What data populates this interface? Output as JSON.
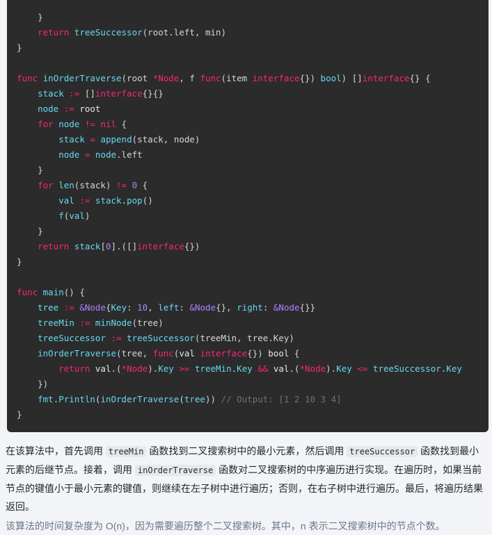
{
  "theme": {
    "page_background": "#f2f4f8",
    "code_background": "#2b2b2b",
    "code_default_text": "#d6d6d6",
    "keyword_color": "#f92672",
    "identifier_color": "#66d9ef",
    "number_color": "#ae81ff",
    "comment_color": "#75715e",
    "prose_color": "#1f2328",
    "prose_dim_color": "#6b7785",
    "inline_code_background": "#e6e8ec"
  },
  "code_block": {
    "language": "go",
    "lines": [
      [
        {
          "t": "    }",
          "c": "pun"
        }
      ],
      [
        {
          "t": "    ",
          "c": "pun"
        },
        {
          "t": "return",
          "c": "kw"
        },
        {
          "t": " ",
          "c": "pun"
        },
        {
          "t": "treeSuccessor",
          "c": "id"
        },
        {
          "t": "(root.left, min)",
          "c": "pun"
        }
      ],
      [
        {
          "t": "}",
          "c": "pun"
        }
      ],
      [
        {
          "t": "",
          "c": "pun"
        }
      ],
      [
        {
          "t": "func",
          "c": "kw"
        },
        {
          "t": " ",
          "c": "pun"
        },
        {
          "t": "inOrderTraverse",
          "c": "id"
        },
        {
          "t": "(root ",
          "c": "pun"
        },
        {
          "t": "*Node",
          "c": "typ"
        },
        {
          "t": ", f ",
          "c": "pun"
        },
        {
          "t": "func",
          "c": "kw"
        },
        {
          "t": "(item ",
          "c": "pun"
        },
        {
          "t": "interface",
          "c": "typ"
        },
        {
          "t": "{}) ",
          "c": "pun"
        },
        {
          "t": "bool",
          "c": "id"
        },
        {
          "t": ") []",
          "c": "pun"
        },
        {
          "t": "interface",
          "c": "typ"
        },
        {
          "t": "{} {",
          "c": "pun"
        }
      ],
      [
        {
          "t": "    ",
          "c": "pun"
        },
        {
          "t": "stack",
          "c": "id"
        },
        {
          "t": " ",
          "c": "pun"
        },
        {
          "t": ":=",
          "c": "kw"
        },
        {
          "t": " []",
          "c": "pun"
        },
        {
          "t": "interface",
          "c": "typ"
        },
        {
          "t": "{}{}",
          "c": "pun"
        }
      ],
      [
        {
          "t": "    ",
          "c": "pun"
        },
        {
          "t": "node",
          "c": "id"
        },
        {
          "t": " ",
          "c": "pun"
        },
        {
          "t": ":=",
          "c": "kw"
        },
        {
          "t": " ",
          "c": "pun"
        },
        {
          "t": "root",
          "c": "plain"
        }
      ],
      [
        {
          "t": "    ",
          "c": "pun"
        },
        {
          "t": "for",
          "c": "kw"
        },
        {
          "t": " ",
          "c": "pun"
        },
        {
          "t": "node",
          "c": "id"
        },
        {
          "t": " ",
          "c": "pun"
        },
        {
          "t": "!=",
          "c": "kw"
        },
        {
          "t": " ",
          "c": "pun"
        },
        {
          "t": "nil",
          "c": "typ"
        },
        {
          "t": " {",
          "c": "pun"
        }
      ],
      [
        {
          "t": "        ",
          "c": "pun"
        },
        {
          "t": "stack",
          "c": "id"
        },
        {
          "t": " ",
          "c": "pun"
        },
        {
          "t": "=",
          "c": "kw"
        },
        {
          "t": " ",
          "c": "pun"
        },
        {
          "t": "append",
          "c": "id"
        },
        {
          "t": "(stack, node)",
          "c": "pun"
        }
      ],
      [
        {
          "t": "        ",
          "c": "pun"
        },
        {
          "t": "node",
          "c": "id"
        },
        {
          "t": " ",
          "c": "pun"
        },
        {
          "t": "=",
          "c": "kw"
        },
        {
          "t": " ",
          "c": "pun"
        },
        {
          "t": "node",
          "c": "id"
        },
        {
          "t": ".left",
          "c": "pun"
        }
      ],
      [
        {
          "t": "    }",
          "c": "pun"
        }
      ],
      [
        {
          "t": "    ",
          "c": "pun"
        },
        {
          "t": "for",
          "c": "kw"
        },
        {
          "t": " ",
          "c": "pun"
        },
        {
          "t": "len",
          "c": "id"
        },
        {
          "t": "(stack) ",
          "c": "pun"
        },
        {
          "t": "!=",
          "c": "kw"
        },
        {
          "t": " ",
          "c": "pun"
        },
        {
          "t": "0",
          "c": "num"
        },
        {
          "t": " {",
          "c": "pun"
        }
      ],
      [
        {
          "t": "        ",
          "c": "pun"
        },
        {
          "t": "val",
          "c": "id"
        },
        {
          "t": " ",
          "c": "pun"
        },
        {
          "t": ":=",
          "c": "kw"
        },
        {
          "t": " ",
          "c": "pun"
        },
        {
          "t": "stack",
          "c": "id"
        },
        {
          "t": ".",
          "c": "pun"
        },
        {
          "t": "pop",
          "c": "id"
        },
        {
          "t": "()",
          "c": "pun"
        }
      ],
      [
        {
          "t": "        ",
          "c": "pun"
        },
        {
          "t": "f",
          "c": "id"
        },
        {
          "t": "(",
          "c": "pun"
        },
        {
          "t": "val",
          "c": "id"
        },
        {
          "t": ")",
          "c": "pun"
        }
      ],
      [
        {
          "t": "    }",
          "c": "pun"
        }
      ],
      [
        {
          "t": "    ",
          "c": "pun"
        },
        {
          "t": "return",
          "c": "kw"
        },
        {
          "t": " ",
          "c": "pun"
        },
        {
          "t": "stack",
          "c": "id"
        },
        {
          "t": "[",
          "c": "pun"
        },
        {
          "t": "0",
          "c": "num"
        },
        {
          "t": "].([]",
          "c": "pun"
        },
        {
          "t": "interface",
          "c": "typ"
        },
        {
          "t": "{})",
          "c": "pun"
        }
      ],
      [
        {
          "t": "}",
          "c": "pun"
        }
      ],
      [
        {
          "t": "",
          "c": "pun"
        }
      ],
      [
        {
          "t": "func",
          "c": "kw"
        },
        {
          "t": " ",
          "c": "pun"
        },
        {
          "t": "main",
          "c": "id"
        },
        {
          "t": "() {",
          "c": "pun"
        }
      ],
      [
        {
          "t": "    ",
          "c": "pun"
        },
        {
          "t": "tree",
          "c": "id"
        },
        {
          "t": " ",
          "c": "pun"
        },
        {
          "t": ":=",
          "c": "kw"
        },
        {
          "t": " ",
          "c": "pun"
        },
        {
          "t": "&Node",
          "c": "pl"
        },
        {
          "t": "{",
          "c": "pun"
        },
        {
          "t": "Key",
          "c": "id"
        },
        {
          "t": ": ",
          "c": "pun"
        },
        {
          "t": "10",
          "c": "num"
        },
        {
          "t": ", ",
          "c": "pun"
        },
        {
          "t": "left",
          "c": "id"
        },
        {
          "t": ": ",
          "c": "pun"
        },
        {
          "t": "&Node",
          "c": "pl"
        },
        {
          "t": "{}, ",
          "c": "pun"
        },
        {
          "t": "right",
          "c": "id"
        },
        {
          "t": ": ",
          "c": "pun"
        },
        {
          "t": "&Node",
          "c": "pl"
        },
        {
          "t": "{}}",
          "c": "pun"
        }
      ],
      [
        {
          "t": "    ",
          "c": "pun"
        },
        {
          "t": "treeMin",
          "c": "id"
        },
        {
          "t": " ",
          "c": "pun"
        },
        {
          "t": ":=",
          "c": "kw"
        },
        {
          "t": " ",
          "c": "pun"
        },
        {
          "t": "minNode",
          "c": "id"
        },
        {
          "t": "(tree)",
          "c": "pun"
        }
      ],
      [
        {
          "t": "    ",
          "c": "pun"
        },
        {
          "t": "treeSuccessor",
          "c": "id"
        },
        {
          "t": " ",
          "c": "pun"
        },
        {
          "t": ":=",
          "c": "kw"
        },
        {
          "t": " ",
          "c": "pun"
        },
        {
          "t": "treeSuccessor",
          "c": "id"
        },
        {
          "t": "(treeMin, tree.Key)",
          "c": "pun"
        }
      ],
      [
        {
          "t": "    ",
          "c": "pun"
        },
        {
          "t": "inOrderTraverse",
          "c": "id"
        },
        {
          "t": "(tree, ",
          "c": "pun"
        },
        {
          "t": "func",
          "c": "kw"
        },
        {
          "t": "(",
          "c": "pun"
        },
        {
          "t": "val",
          "c": "plain"
        },
        {
          "t": " ",
          "c": "pun"
        },
        {
          "t": "interface",
          "c": "typ"
        },
        {
          "t": "{}) ",
          "c": "pun"
        },
        {
          "t": "bool",
          "c": "plain"
        },
        {
          "t": " {",
          "c": "pun"
        }
      ],
      [
        {
          "t": "        ",
          "c": "pun"
        },
        {
          "t": "return",
          "c": "kw"
        },
        {
          "t": " ",
          "c": "pun"
        },
        {
          "t": "val",
          "c": "plain"
        },
        {
          "t": ".(",
          "c": "pun"
        },
        {
          "t": "*Node",
          "c": "typ"
        },
        {
          "t": ").",
          "c": "pun"
        },
        {
          "t": "Key",
          "c": "id"
        },
        {
          "t": " ",
          "c": "pun"
        },
        {
          "t": ">=",
          "c": "kw"
        },
        {
          "t": " ",
          "c": "pun"
        },
        {
          "t": "treeMin",
          "c": "id"
        },
        {
          "t": ".",
          "c": "pun"
        },
        {
          "t": "Key",
          "c": "id"
        },
        {
          "t": " ",
          "c": "pun"
        },
        {
          "t": "&&",
          "c": "kw"
        },
        {
          "t": " ",
          "c": "pun"
        },
        {
          "t": "val",
          "c": "plain"
        },
        {
          "t": ".(",
          "c": "pun"
        },
        {
          "t": "*Node",
          "c": "typ"
        },
        {
          "t": ").",
          "c": "pun"
        },
        {
          "t": "Key",
          "c": "id"
        },
        {
          "t": " ",
          "c": "pun"
        },
        {
          "t": "<=",
          "c": "kw"
        },
        {
          "t": " ",
          "c": "pun"
        },
        {
          "t": "treeSuccessor",
          "c": "id"
        },
        {
          "t": ".",
          "c": "pun"
        },
        {
          "t": "Key",
          "c": "id"
        }
      ],
      [
        {
          "t": "    })",
          "c": "pun"
        }
      ],
      [
        {
          "t": "    ",
          "c": "pun"
        },
        {
          "t": "fmt",
          "c": "id"
        },
        {
          "t": ".",
          "c": "pun"
        },
        {
          "t": "Println",
          "c": "id"
        },
        {
          "t": "(",
          "c": "pun"
        },
        {
          "t": "inOrderTraverse",
          "c": "id"
        },
        {
          "t": "(",
          "c": "pun"
        },
        {
          "t": "tree",
          "c": "id"
        },
        {
          "t": ")) ",
          "c": "pun"
        },
        {
          "t": "// Output: [1 2 10 3 4]",
          "c": "cmt"
        }
      ],
      [
        {
          "t": "}",
          "c": "pun"
        }
      ]
    ]
  },
  "prose": {
    "paragraph_1": [
      {
        "t": "在该算法中，首先调用 ",
        "code": false
      },
      {
        "t": "treeMin",
        "code": true
      },
      {
        "t": " 函数找到二叉搜索树中的最小元素，然后调用 ",
        "code": false
      },
      {
        "t": "treeSuccessor",
        "code": true
      },
      {
        "t": " 函数找到最小元素的后继节点。接着，调用 ",
        "code": false
      },
      {
        "t": "inOrderTraverse",
        "code": true
      },
      {
        "t": " 函数对二叉搜索树的中序遍历进行实现。在遍历时，如果当前节点的键值小于最小元素的键值，则继续在左子树中进行遍历；否则，在右子树中进行遍历。最后，将遍历结果返回。",
        "code": false
      }
    ],
    "paragraph_2": "该算法的时间复杂度为 O(n)，因为需要遍历整个二叉搜索树。其中，n 表示二叉搜索树中的节点个数。"
  }
}
